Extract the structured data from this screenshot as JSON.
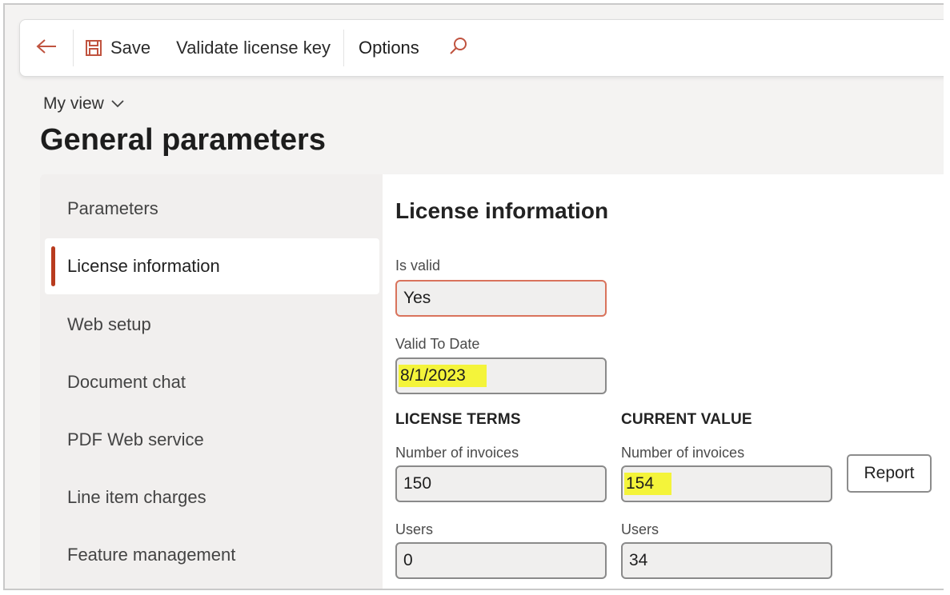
{
  "toolbar": {
    "save_label": "Save",
    "validate_label": "Validate license key",
    "options_label": "Options"
  },
  "view": {
    "label": "My view"
  },
  "page": {
    "title": "General parameters"
  },
  "nav": {
    "items": [
      {
        "label": "Parameters"
      },
      {
        "label": "License information"
      },
      {
        "label": "Web setup"
      },
      {
        "label": "Document chat"
      },
      {
        "label": "PDF Web service"
      },
      {
        "label": "Line item charges"
      },
      {
        "label": "Feature management"
      }
    ]
  },
  "license": {
    "title": "License information",
    "is_valid": {
      "label": "Is valid",
      "value": "Yes"
    },
    "valid_to": {
      "label": "Valid To Date",
      "value": "8/1/2023"
    },
    "terms": {
      "heading": "LICENSE TERMS",
      "invoices": {
        "label": "Number of invoices",
        "value": "150"
      },
      "users": {
        "label": "Users",
        "value": "0"
      }
    },
    "current": {
      "heading": "CURRENT VALUE",
      "invoices": {
        "label": "Number of invoices",
        "value": "154"
      },
      "users": {
        "label": "Users",
        "value": "34"
      }
    },
    "report_label": "Report"
  },
  "colors": {
    "accent": "#b83b1e",
    "highlight": "#f4f43a",
    "invalid_border": "#d9735c"
  }
}
